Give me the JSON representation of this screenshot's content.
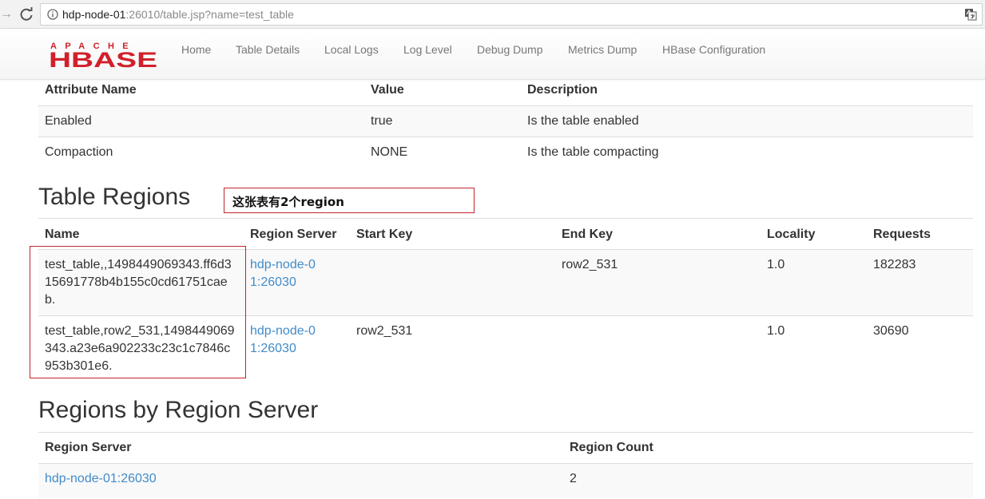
{
  "browser": {
    "url_host": "hdp-node-01",
    "url_rest": ":26010/table.jsp?name=test_table"
  },
  "navbar": {
    "logo_top": "APACHE",
    "logo_main": "HBASE",
    "items": [
      "Home",
      "Table Details",
      "Local Logs",
      "Log Level",
      "Debug Dump",
      "Metrics Dump",
      "HBase Configuration"
    ]
  },
  "attributes": {
    "headers": [
      "Attribute Name",
      "Value",
      "Description"
    ],
    "rows": [
      [
        "Enabled",
        "true",
        "Is the table enabled"
      ],
      [
        "Compaction",
        "NONE",
        "Is the table compacting"
      ]
    ]
  },
  "table_regions": {
    "title": "Table Regions",
    "annotation": "这张表有2个region",
    "headers": [
      "Name",
      "Region Server",
      "Start Key",
      "End Key",
      "Locality",
      "Requests"
    ],
    "rows": [
      {
        "name": "test_table,,1498449069343.ff6d315691778b4b155c0cd61751caeb.",
        "server": "hdp-node-01:26030",
        "start_key": "",
        "end_key": "row2_531",
        "locality": "1.0",
        "requests": "182283"
      },
      {
        "name": "test_table,row2_531,1498449069343.a23e6a902233c23c1c7846c953b301e6.",
        "server": "hdp-node-01:26030",
        "start_key": "row2_531",
        "end_key": "",
        "locality": "1.0",
        "requests": "30690"
      }
    ]
  },
  "regions_by_server": {
    "title": "Regions by Region Server",
    "headers": [
      "Region Server",
      "Region Count"
    ],
    "rows": [
      [
        "hdp-node-01:26030",
        "2"
      ]
    ]
  },
  "colors": {
    "link": "#428bca",
    "annotation_border": "#c0262c",
    "logo_red": "#d1202a"
  }
}
